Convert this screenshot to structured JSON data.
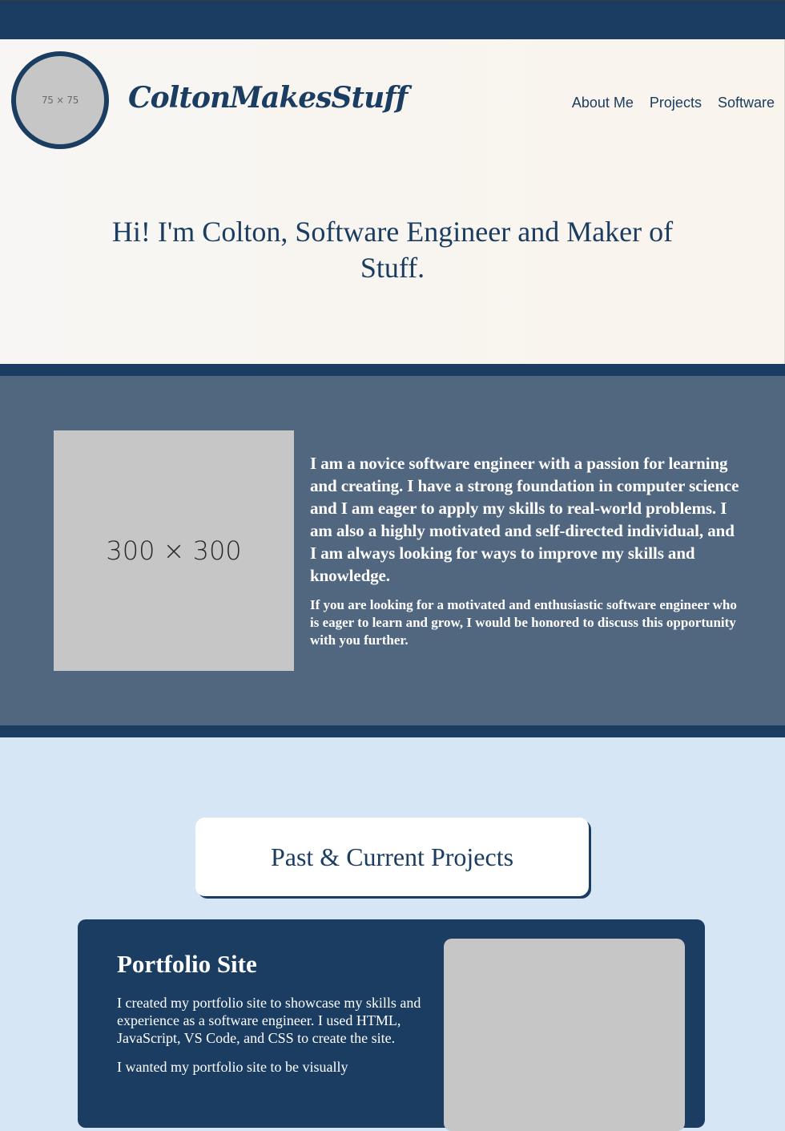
{
  "header": {
    "logo_placeholder": "75 × 75",
    "brand": "ColtonMakesStuff",
    "nav": [
      {
        "label": "About Me"
      },
      {
        "label": "Projects"
      },
      {
        "label": "Software"
      }
    ],
    "hero_title": "Hi! I'm Colton, Software Engineer and Maker of Stuff."
  },
  "about": {
    "image_placeholder": "300 × 300",
    "paragraph_1": "I am a novice software engineer with a passion for learning and creating. I have a strong foundation in computer science and I am eager to apply my skills to real-world problems. I am also a highly motivated and self-directed individual, and I am always looking for ways to improve my skills and knowledge.",
    "paragraph_2": "If you are looking for a motivated and enthusiastic software engineer who is eager to learn and grow, I would be honored to discuss this opportunity with you further."
  },
  "projects": {
    "heading": "Past & Current Projects",
    "items": [
      {
        "title": "Portfolio Site",
        "desc_1": "I created my portfolio site to showcase my skills and experience as a software engineer. I used HTML, JavaScript, VS Code, and CSS to create the site.",
        "desc_2": "I wanted my portfolio site to be visually"
      }
    ]
  },
  "colors": {
    "navy": "#1a3d61",
    "slate": "#51667f",
    "light_blue": "#d6e6f5",
    "cream": "#f9f4ec",
    "placeholder_gray": "#c6c6c6"
  }
}
